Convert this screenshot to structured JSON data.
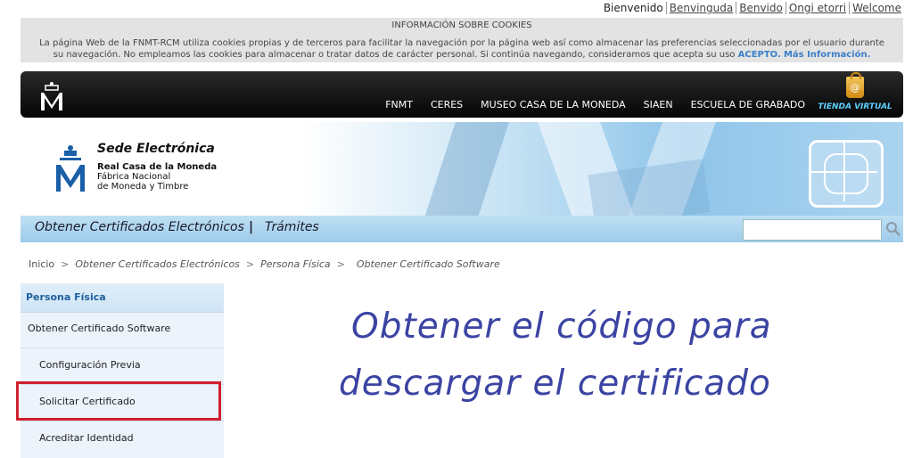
{
  "lang_bar": {
    "welcome": "Bienvenido",
    "links": [
      "Benvinguda",
      "Benvido",
      "Ongi etorri",
      "Welcome"
    ]
  },
  "cookies": {
    "title": "INFORMACIÓN SOBRE COOKIES",
    "body": "La página Web de la FNMT-RCM utiliza cookies propias y de terceros para facilitar la navegación por la página web así como almacenar las preferencias seleccionadas por el usuario durante su navegación. No empleamos las cookies para almacenar o tratar datos de carácter personal. Si continúa navegando, consideramos que acepta su uso",
    "accept": "ACEPTO.",
    "more": "Más Información."
  },
  "topnav": {
    "logo_icon": "crown-m-logo-icon",
    "items": [
      "FNMT",
      "CERES",
      "MUSEO CASA DE LA MONEDA",
      "SIAEN",
      "ESCUELA DE GRABADO"
    ],
    "store_label": "TIENDA VIRTUAL",
    "store_icon": "shopping-bag-icon",
    "store_symbol": "@"
  },
  "banner": {
    "title": "Sede Electrónica",
    "org_line1": "Real Casa de la Moneda",
    "org_line2": "Fábrica Nacional",
    "org_line3": "de Moneda y Timbre"
  },
  "bluebar": {
    "item1": "Obtener Certificados Electrónicos",
    "divider": "|",
    "item2": "Trámites",
    "search_placeholder": "",
    "search_icon": "magnifier-icon"
  },
  "breadcrumb": {
    "items": [
      "Inicio",
      "Obtener Certificados Electrónicos",
      "Persona Física",
      "Obtener Certificado Software"
    ],
    "sep": ">"
  },
  "sidebar": {
    "header": "Persona Física",
    "items": [
      "Obtener Certificado Software",
      "Configuración Previa",
      "Solicitar Certificado",
      "Acreditar Identidad"
    ]
  },
  "main": {
    "heading_line1": "Obtener el código para",
    "heading_line2": "descargar el certificado"
  },
  "colors": {
    "accent_blue": "#3b44a3",
    "highlight_red": "#d0202f",
    "topnav_bg": "#111111"
  }
}
